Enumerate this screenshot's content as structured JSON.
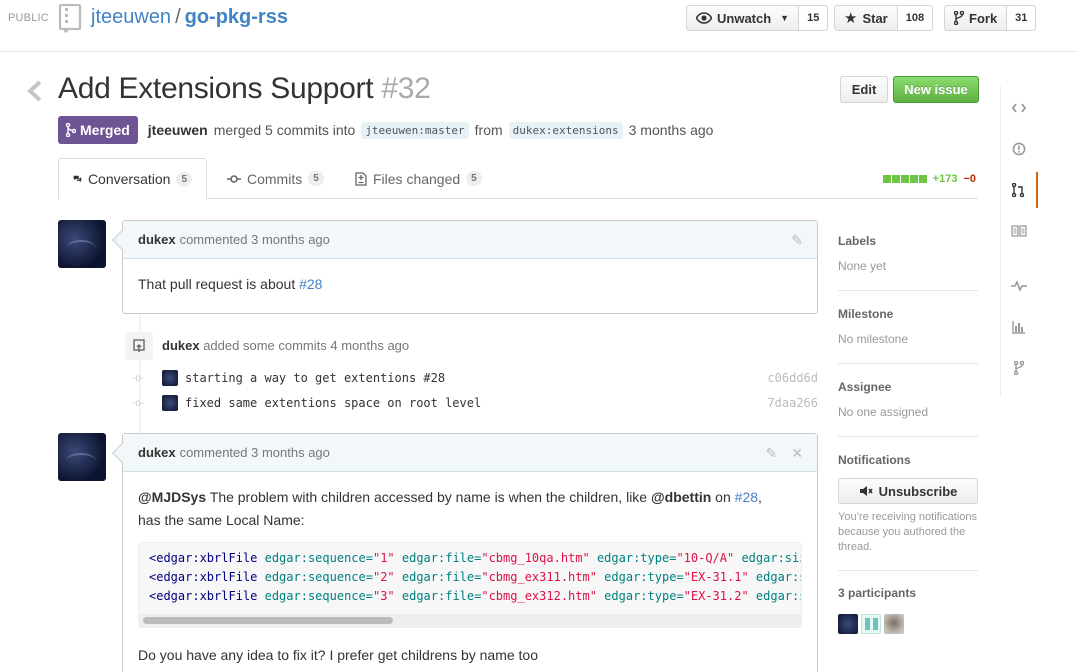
{
  "header": {
    "visibility": "PUBLIC",
    "owner": "jteeuwen",
    "separator": "/",
    "repo": "go-pkg-rss",
    "watch": {
      "label": "Unwatch",
      "count": "15"
    },
    "star": {
      "label": "Star",
      "count": "108"
    },
    "fork": {
      "label": "Fork",
      "count": "31"
    }
  },
  "pull_request": {
    "title": "Add Extensions Support",
    "number": "#32",
    "edit_label": "Edit",
    "new_issue_label": "New issue",
    "state": "Merged",
    "merged_by": "jteeuwen",
    "merge_text": "merged 5 commits into",
    "base_branch": "jteeuwen:master",
    "from_text": "from",
    "head_branch": "dukex:extensions",
    "time": "3 months ago"
  },
  "tabs": [
    {
      "label": "Conversation",
      "count": "5"
    },
    {
      "label": "Commits",
      "count": "5"
    },
    {
      "label": "Files changed",
      "count": "5"
    }
  ],
  "diffstat": {
    "additions": "+173",
    "deletions": "−0"
  },
  "comment1": {
    "author": "dukex",
    "action": "commented 3 months ago",
    "body_text": "That pull request is about ",
    "body_link": "#28"
  },
  "event": {
    "author": "dukex",
    "text": "added some commits 4 months ago",
    "commits": [
      {
        "message": "starting a way to get extentions #28",
        "sha": "c06dd6d"
      },
      {
        "message": "fixed same extentions space on root level",
        "sha": "7daa266"
      }
    ]
  },
  "comment2": {
    "author": "dukex",
    "action": "commented 3 months ago",
    "mention1": "@MJDSys",
    "text1": " The problem with children accessed by name is when the children, like ",
    "mention2": "@dbettin",
    "text2": " on ",
    "link": "#28",
    "text3": ",",
    "text4": "has the same Local Name:",
    "code_lines": [
      {
        "tag": "<edgar:xbrlFile",
        "a1": " edgar:sequence=",
        "v1": "\"1\"",
        "a2": " edgar:file=",
        "v2": "\"cbmg_10qa.htm\"",
        "a3": " edgar:type=",
        "v3": "\"10-Q/A\"",
        "a4": " edgar:size="
      },
      {
        "tag": "<edgar:xbrlFile",
        "a1": " edgar:sequence=",
        "v1": "\"2\"",
        "a2": " edgar:file=",
        "v2": "\"cbmg_ex311.htm\"",
        "a3": " edgar:type=",
        "v3": "\"EX-31.1\"",
        "a4": " edgar:siz"
      },
      {
        "tag": "<edgar:xbrlFile",
        "a1": " edgar:sequence=",
        "v1": "\"3\"",
        "a2": " edgar:file=",
        "v2": "\"cbmg_ex312.htm\"",
        "a3": " edgar:type=",
        "v3": "\"EX-31.2\"",
        "a4": " edgar:siz"
      }
    ],
    "text5": "Do you have any idea to fix it? I prefer get childrens by name too"
  },
  "sidebar": {
    "labels_heading": "Labels",
    "labels_value": "None yet",
    "milestone_heading": "Milestone",
    "milestone_value": "No milestone",
    "assignee_heading": "Assignee",
    "assignee_value": "No one assigned",
    "notifications_heading": "Notifications",
    "unsubscribe_label": "Unsubscribe",
    "notifications_reason": "You’re receiving notifications because you authored the thread.",
    "participants_heading": "3 participants"
  },
  "colors": {
    "link": "#4183c4",
    "merged": "#6e5494",
    "new_issue": "#60b044",
    "additions": "#6cc644",
    "deletions": "#bd2c00",
    "active_nav": "#d26911"
  }
}
